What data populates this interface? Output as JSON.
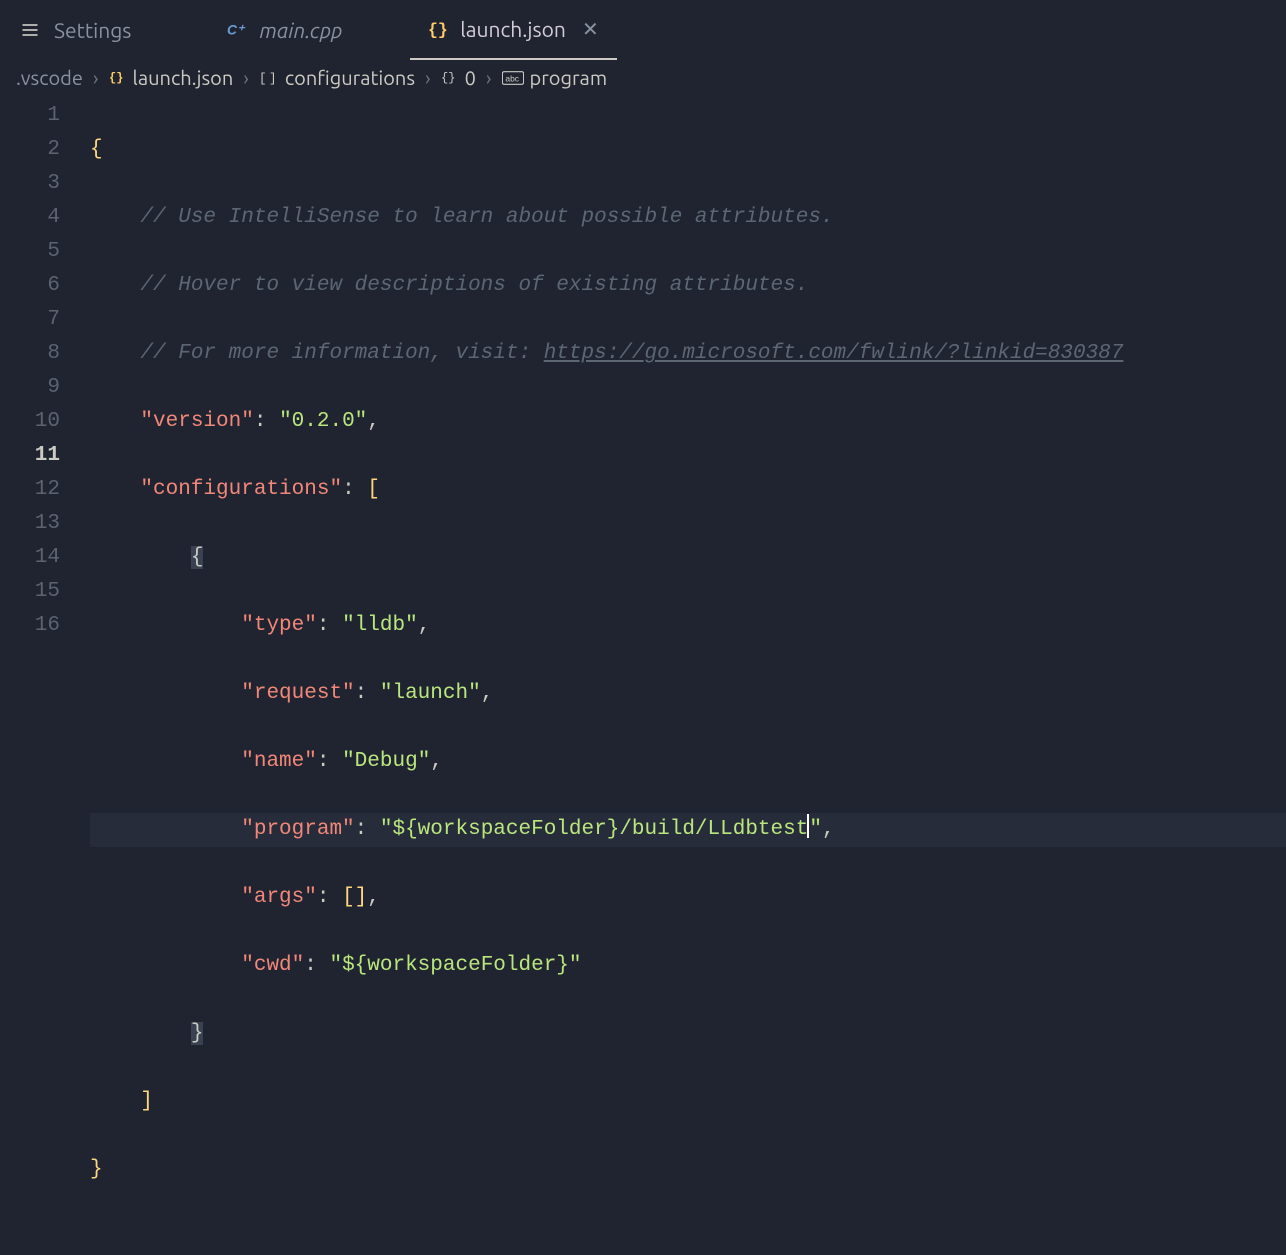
{
  "tabs": {
    "settings": "Settings",
    "main": "main.cpp",
    "launch": "launch.json"
  },
  "breadcrumb": {
    "root": ".vscode",
    "file": "launch.json",
    "path1": "configurations",
    "path2": "0",
    "path3": "program"
  },
  "code": {
    "comment1": "// Use IntelliSense to learn about possible attributes.",
    "comment2": "// Hover to view descriptions of existing attributes.",
    "comment3a": "// For more information, visit: ",
    "comment3url": "https://go.microsoft.com/fwlink/?linkid=830387",
    "version_key": "\"version\"",
    "version_val": "\"0.2.0\"",
    "configs_key": "\"configurations\"",
    "type_key": "\"type\"",
    "type_val": "\"lldb\"",
    "request_key": "\"request\"",
    "request_val": "\"launch\"",
    "name_key": "\"name\"",
    "name_val": "\"Debug\"",
    "program_key": "\"program\"",
    "program_val_a": "\"${workspaceFolder}/build/LLdbtest",
    "program_val_b": "\"",
    "args_key": "\"args\"",
    "cwd_key": "\"cwd\"",
    "cwd_val": "\"${workspaceFolder}\""
  },
  "lines": [
    "1",
    "2",
    "3",
    "4",
    "5",
    "6",
    "7",
    "8",
    "9",
    "10",
    "11",
    "12",
    "13",
    "14",
    "15",
    "16"
  ]
}
